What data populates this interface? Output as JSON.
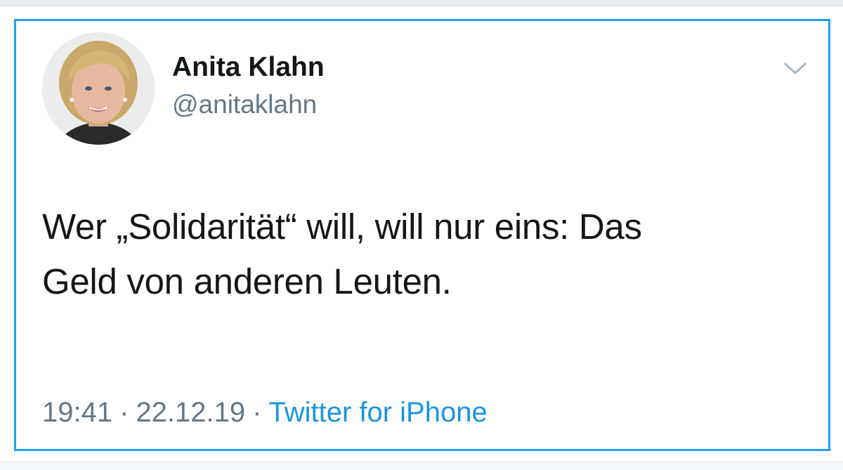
{
  "tweet": {
    "author": {
      "display_name": "Anita Klahn",
      "handle": "@anitaklahn"
    },
    "text_line1": "Wer „Solidarität“ will, will nur eins: Das",
    "text_line2": "Geld von anderen Leuten.",
    "time": "19:41",
    "separator": "·",
    "date": "22.12.19",
    "source": "Twitter for iPhone",
    "menu_icon": "chevron-down-icon"
  },
  "colors": {
    "card_border": "#1da1f2",
    "text": "#14171a",
    "muted": "#657786",
    "link": "#1b95e0"
  }
}
